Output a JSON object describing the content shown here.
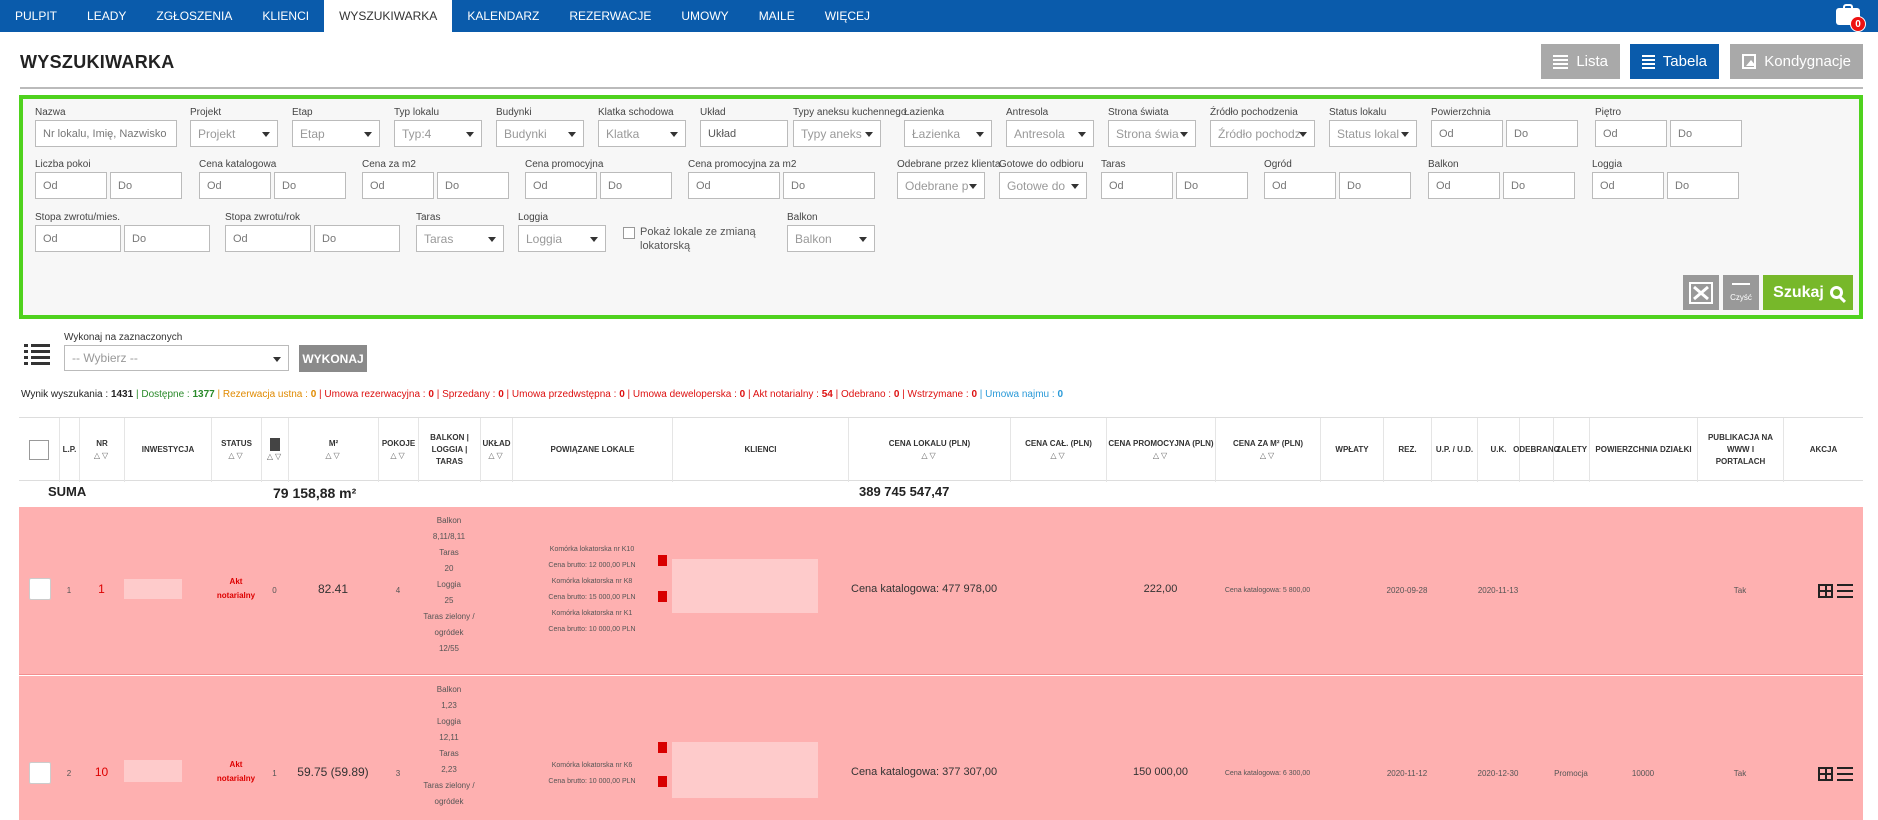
{
  "nav": {
    "items": [
      "PULPIT",
      "LEADY",
      "ZGŁOSZENIA",
      "KLIENCI",
      "WYSZUKIWARKA",
      "KALENDARZ",
      "REZERWACJE",
      "UMOWY",
      "MAILE",
      "WIĘCEJ"
    ],
    "active": "WYSZUKIWARKA",
    "badge": "0"
  },
  "page": {
    "title": "WYSZUKIWARKA"
  },
  "views": {
    "lista": "Lista",
    "tabela": "Tabela",
    "kondygnacje": "Kondygnacje"
  },
  "filters": {
    "nazwa": {
      "label": "Nazwa",
      "placeholder": "Nr lokalu, Imię, Nazwisko"
    },
    "projekt": {
      "label": "Projekt",
      "value": "Projekt"
    },
    "etap": {
      "label": "Etap",
      "value": "Etap"
    },
    "typ_lokalu": {
      "label": "Typ lokalu",
      "value": "Typ:4"
    },
    "budynki": {
      "label": "Budynki",
      "value": "Budynki"
    },
    "klatka": {
      "label": "Klatka schodowa",
      "value": "Klatka"
    },
    "uklad": {
      "label": "Układ",
      "placeholder": "Układ"
    },
    "typy_aneksu": {
      "label": "Typy aneksu kuchennego",
      "value": "Typy aneks"
    },
    "lazienka": {
      "label": "Łazienka",
      "value": "Łazienka"
    },
    "antresola": {
      "label": "Antresola",
      "value": "Antresola"
    },
    "strona_swiata": {
      "label": "Strona świata",
      "value": "Strona świa"
    },
    "zrodlo": {
      "label": "Źródło pochodzenia",
      "value": "Źródło pochodz"
    },
    "status_lokalu": {
      "label": "Status lokalu",
      "value": "Status lokal"
    },
    "powierzchnia": {
      "label": "Powierzchnia",
      "od": "Od",
      "do": "Do"
    },
    "pietro": {
      "label": "Piętro",
      "od": "Od",
      "do": "Do"
    },
    "liczba_pokoi": {
      "label": "Liczba pokoi",
      "od": "Od",
      "do": "Do"
    },
    "cena_katalogowa": {
      "label": "Cena katalogowa",
      "od": "Od",
      "do": "Do"
    },
    "cena_m2": {
      "label": "Cena za m2",
      "od": "Od",
      "do": "Do"
    },
    "cena_promocyjna": {
      "label": "Cena promocyjna",
      "od": "Od",
      "do": "Do"
    },
    "cena_prom_m2": {
      "label": "Cena promocyjna za m2",
      "od": "Od",
      "do": "Do"
    },
    "odebrane": {
      "label": "Odebrane przez klienta",
      "value": "Odebrane p"
    },
    "gotowe": {
      "label": "Gotowe do odbioru",
      "value": "Gotowe do"
    },
    "taras_range": {
      "label": "Taras",
      "od": "Od",
      "do": "Do"
    },
    "ogrod": {
      "label": "Ogród",
      "od": "Od",
      "do": "Do"
    },
    "balkon_range": {
      "label": "Balkon",
      "od": "Od",
      "do": "Do"
    },
    "loggia_range": {
      "label": "Loggia",
      "od": "Od",
      "do": "Do"
    },
    "stopa_mies": {
      "label": "Stopa zwrotu/mies.",
      "od": "Od",
      "do": "Do"
    },
    "stopa_rok": {
      "label": "Stopa zwrotu/rok",
      "od": "Od",
      "do": "Do"
    },
    "taras_sel": {
      "label": "Taras",
      "value": "Taras"
    },
    "loggia_sel": {
      "label": "Loggia",
      "value": "Loggia"
    },
    "zmiana": {
      "label": "Pokaż lokale ze zmianą lokatorską"
    },
    "balkon_sel": {
      "label": "Balkon",
      "value": "Balkon"
    },
    "czysc": "Czyść",
    "szukaj": "Szukaj"
  },
  "bulk": {
    "label": "Wykonaj na zaznaczonych",
    "value": "-- Wybierz --",
    "button": "WYKONAJ"
  },
  "summary": [
    {
      "text": "Wynik wyszukania : ",
      "count": "1431",
      "color": "#222"
    },
    {
      "text": " | Dostępne : ",
      "count": "1377",
      "color": "#2a8a2a"
    },
    {
      "text": " | Rezerwacja ustna : ",
      "count": "0",
      "color": "#e08a00"
    },
    {
      "text": " | Umowa rezerwacyjna : ",
      "count": "0",
      "color": "#d11"
    },
    {
      "text": " | Sprzedany : ",
      "count": "0",
      "color": "#d11"
    },
    {
      "text": " | Umowa przedwstępna : ",
      "count": "0",
      "color": "#d11"
    },
    {
      "text": " | Umowa deweloperska : ",
      "count": "0",
      "color": "#d11"
    },
    {
      "text": " | Akt notarialny : ",
      "count": "54",
      "color": "#d11"
    },
    {
      "text": " | Odebrano : ",
      "count": "0",
      "color": "#d11"
    },
    {
      "text": " | Wstrzymane : ",
      "count": "0",
      "color": "#d11"
    },
    {
      "text": " | Umowa najmu : ",
      "count": "0",
      "color": "#2a9ad8"
    }
  ],
  "table": {
    "headers": {
      "lp": "L.P.",
      "nr": "NR",
      "inwestycja": "INWESTYCJA",
      "status": "STATUS",
      "m2": "M²",
      "pokoje": "POKOJE",
      "balkon": "BALKON | LOGGIA | TARAS",
      "uklad": "UKŁAD",
      "powiazane": "POWIĄZANE LOKALE",
      "klienci": "KLIENCI",
      "cena_lokalu": "CENA LOKALU (PLN)",
      "cena_cal": "CENA CAŁ. (PLN)",
      "cena_prom": "CENA PROMOCYJNA (PLN)",
      "cena_m2": "CENA ZA M² (PLN)",
      "wplaty": "WPŁATY",
      "rez": "REZ.",
      "up_ud": "U.P. / U.D.",
      "uk": "U.K.",
      "odebrano": "ODEBRANO",
      "zalety": "ZALETY",
      "powierzchnia_dzialki": "POWIERZCHNIA DZIAŁKI",
      "publikacja": "PUBLIKACJA NA WWW I PORTALACH",
      "akcja": "AKCJA"
    },
    "suma": {
      "label": "SUMA",
      "area": "79 158,88 m²",
      "price": "389 745 547,47"
    },
    "rows": [
      {
        "lp": "1",
        "nr": "1",
        "status": "Akt notarialny",
        "icon_count": "0",
        "m2": "82.41",
        "pokoje": "4",
        "balkon": [
          "Balkon",
          "8,11/8,11",
          "Taras",
          "20",
          "Loggia",
          "25",
          "Taras zielony / ogródek",
          "12/55"
        ],
        "powiazane": [
          "Komórka lokatorska nr K10",
          "Cena brutto: 12 000,00 PLN",
          "Komórka lokatorska nr K8",
          "Cena brutto: 15 000,00 PLN",
          "Komórka lokatorska nr K1",
          "Cena brutto: 10 000,00 PLN"
        ],
        "cena_lokalu": "Cena katalogowa: 477 978,00",
        "cena_prom": "222,00",
        "cena_m2": "Cena katalogowa: 5 800,00",
        "rez": "2020-09-28",
        "uk": "2020-11-13",
        "zalety": "",
        "dzialka": "",
        "publikacja": "Tak"
      },
      {
        "lp": "2",
        "nr": "10",
        "status": "Akt notarialny",
        "icon_count": "1",
        "m2": "59.75 (59.89)",
        "pokoje": "3",
        "balkon": [
          "Balkon",
          "1,23",
          "Loggia",
          "12,11",
          "Taras",
          "2,23",
          "Taras zielony /",
          "ogródek"
        ],
        "powiazane": [
          "Komórka lokatorska nr K6",
          "Cena brutto: 10 000,00 PLN"
        ],
        "cena_lokalu": "Cena katalogowa: 377 307,00",
        "cena_prom": "150 000,00",
        "cena_m2": "Cena katalogowa: 6 300,00",
        "rez": "2020-11-12",
        "uk": "2020-12-30",
        "zalety": "Promocja",
        "dzialka": "10000",
        "publikacja": "Tak"
      }
    ]
  }
}
